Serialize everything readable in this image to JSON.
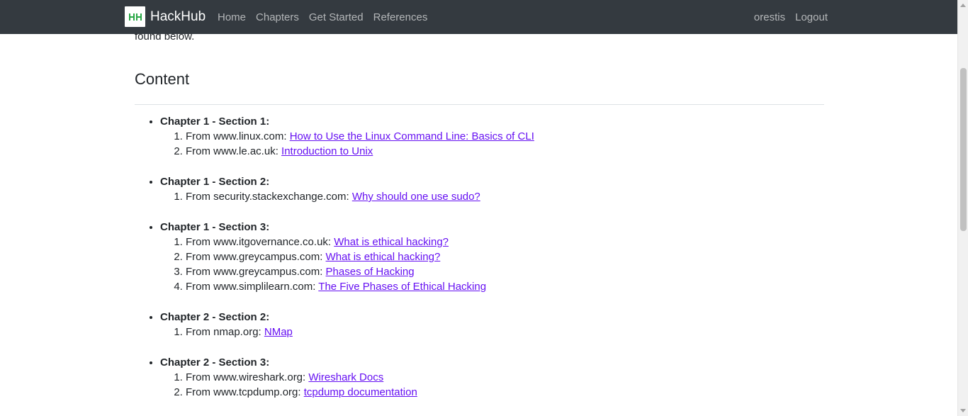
{
  "navbar": {
    "brand": "HackHub",
    "logo_text": "HH",
    "logo_color": "#28a745",
    "background": "#343a40",
    "links": [
      "Home",
      "Chapters",
      "Get Started",
      "References"
    ],
    "user": "orestis",
    "logout": "Logout"
  },
  "intro_tail": "found below.",
  "content_heading": "Content",
  "link_color": "#6610f2",
  "chapters": [
    {
      "title": "Chapter 1 - Section 1:",
      "refs": [
        {
          "source": "From www.linux.com:",
          "link": "How to Use the Linux Command Line: Basics of CLI"
        },
        {
          "source": "From www.le.ac.uk:",
          "link": "Introduction to Unix"
        }
      ]
    },
    {
      "title": "Chapter 1 - Section 2:",
      "refs": [
        {
          "source": "From security.stackexchange.com:",
          "link": "Why should one use sudo?"
        }
      ]
    },
    {
      "title": "Chapter 1 - Section 3:",
      "refs": [
        {
          "source": "From www.itgovernance.co.uk:",
          "link": "What is ethical hacking?"
        },
        {
          "source": "From www.greycampus.com:",
          "link": "What is ethical hacking?"
        },
        {
          "source": "From www.greycampus.com:",
          "link": "Phases of Hacking"
        },
        {
          "source": "From www.simplilearn.com:",
          "link": "The Five Phases of Ethical Hacking"
        }
      ]
    },
    {
      "title": "Chapter 2 - Section 2:",
      "refs": [
        {
          "source": "From nmap.org:",
          "link": "NMap"
        }
      ]
    },
    {
      "title": "Chapter 2 - Section 3:",
      "refs": [
        {
          "source": "From www.wireshark.org:",
          "link": "Wireshark Docs"
        },
        {
          "source": "From www.tcpdump.org:",
          "link": "tcpdump documentation"
        }
      ]
    }
  ]
}
